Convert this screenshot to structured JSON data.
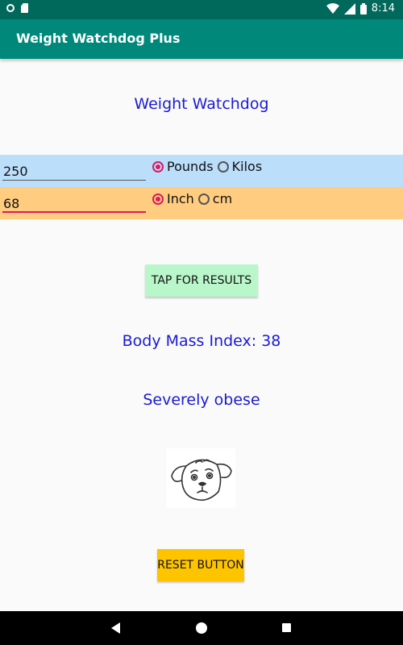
{
  "status_bar": {
    "time": "8:14",
    "icons": [
      "circle-icon",
      "sd-card-icon",
      "wifi-icon",
      "signal-icon",
      "battery-icon"
    ]
  },
  "app_bar": {
    "title": "Weight Watchdog Plus"
  },
  "heading": "Weight Watchdog",
  "weight_row": {
    "value": "250",
    "options": [
      {
        "label": "Pounds",
        "selected": true
      },
      {
        "label": "Kilos",
        "selected": false
      }
    ],
    "background": "#bbdefb"
  },
  "height_row": {
    "value": "68",
    "options": [
      {
        "label": "Inch",
        "selected": true
      },
      {
        "label": "cm",
        "selected": false
      }
    ],
    "background": "#ffcc80"
  },
  "results_button": {
    "label": "TAP FOR RESULTS",
    "color": "#b9f6ca"
  },
  "bmi_text": "Body Mass Index: 38",
  "category_text": "Severely obese",
  "dog_image": {
    "icon": "worried-dog-face"
  },
  "reset_button": {
    "label": "RESET BUTTON",
    "color": "#ffc400"
  },
  "colors": {
    "accent": "#d81b60",
    "text_blue": "#1a1ad6",
    "primary": "#00897b",
    "primary_dark": "#00695c"
  }
}
